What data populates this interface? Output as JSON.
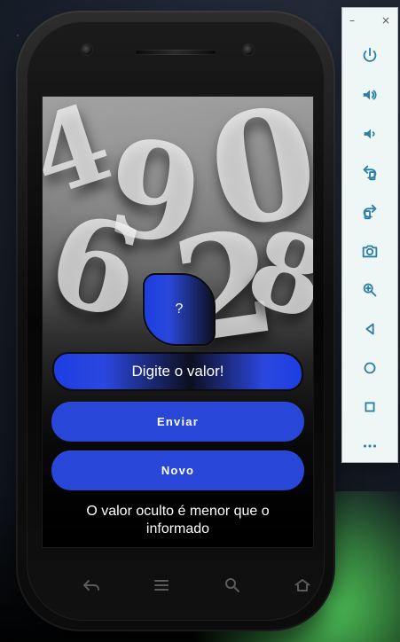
{
  "app": {
    "shield_text": "?",
    "input_text": "Digite o valor!",
    "buttons": {
      "send": "Enviar",
      "new": "Novo"
    },
    "message": "O valor oculto é menor que o informado"
  },
  "phone_nav": {
    "icons": [
      "back-icon",
      "menu-icon",
      "search-icon",
      "home-icon"
    ]
  },
  "emulator_panel": {
    "window_controls": {
      "minimize": "–",
      "close": "×"
    },
    "icons": [
      "power-icon",
      "volume-up-icon",
      "volume-down-icon",
      "rotate-left-icon",
      "rotate-right-icon",
      "camera-icon",
      "zoom-icon",
      "back-triangle-icon",
      "home-circle-icon",
      "overview-square-icon",
      "more-icon"
    ]
  },
  "colors": {
    "accent_blue": "#2846d8",
    "panel_icon": "#2e7ea6",
    "panel_bg": "#eef6f6",
    "ground_green": "#55d25f"
  }
}
